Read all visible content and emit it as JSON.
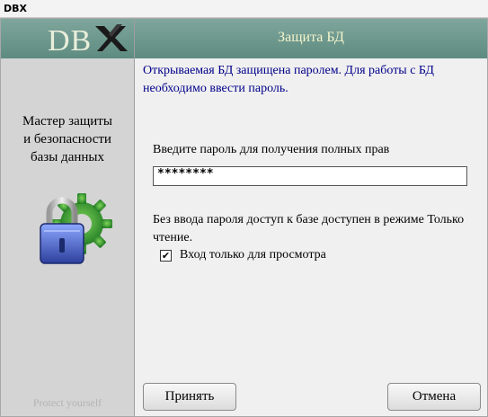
{
  "window": {
    "title": "DBX"
  },
  "sidebar": {
    "logo": "DB",
    "title_lines": [
      "Мастер защиты",
      "и безопасности",
      "базы данных"
    ],
    "footer": "Protect yourself"
  },
  "header": {
    "title": "Защита БД"
  },
  "content": {
    "info": "Открываемая БД защищена паролем. Для работы с БД необходимо ввести пароль.",
    "password_label": "Введите пароль для получения полных прав",
    "password_value": "********",
    "readonly_text": "Без ввода пароля доступ к базе доступен в режиме Только чтение.",
    "readonly_checkbox_label": "Вход только для просмотра",
    "readonly_checked": true
  },
  "buttons": {
    "accept": "Принять",
    "cancel": "Отмена"
  },
  "colors": {
    "header": "#6f998e",
    "header_text": "#f4f4cc",
    "info_text": "#00008b",
    "sidebar": "#d4d4d4"
  }
}
